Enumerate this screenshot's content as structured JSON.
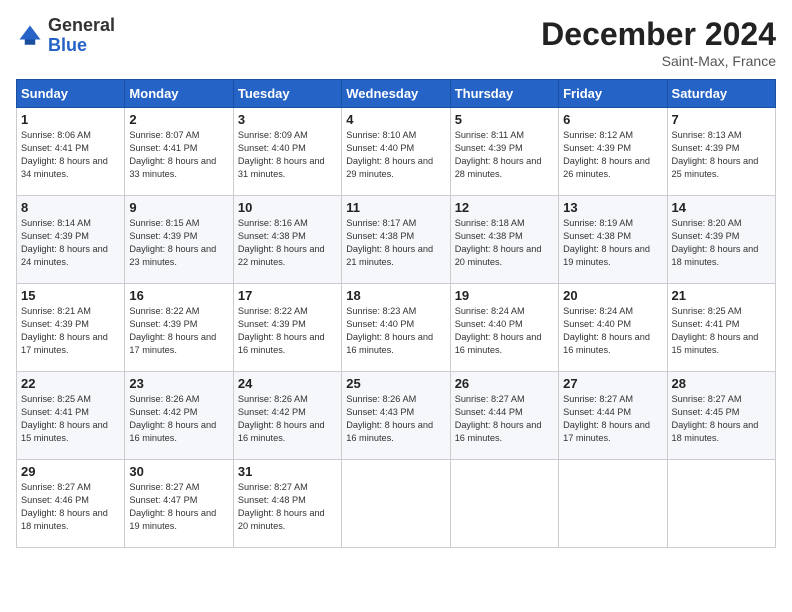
{
  "header": {
    "logo_general": "General",
    "logo_blue": "Blue",
    "month": "December 2024",
    "location": "Saint-Max, France"
  },
  "days_of_week": [
    "Sunday",
    "Monday",
    "Tuesday",
    "Wednesday",
    "Thursday",
    "Friday",
    "Saturday"
  ],
  "weeks": [
    [
      {
        "day": "1",
        "rise": "Sunrise: 8:06 AM",
        "set": "Sunset: 4:41 PM",
        "daylight": "Daylight: 8 hours and 34 minutes."
      },
      {
        "day": "2",
        "rise": "Sunrise: 8:07 AM",
        "set": "Sunset: 4:41 PM",
        "daylight": "Daylight: 8 hours and 33 minutes."
      },
      {
        "day": "3",
        "rise": "Sunrise: 8:09 AM",
        "set": "Sunset: 4:40 PM",
        "daylight": "Daylight: 8 hours and 31 minutes."
      },
      {
        "day": "4",
        "rise": "Sunrise: 8:10 AM",
        "set": "Sunset: 4:40 PM",
        "daylight": "Daylight: 8 hours and 29 minutes."
      },
      {
        "day": "5",
        "rise": "Sunrise: 8:11 AM",
        "set": "Sunset: 4:39 PM",
        "daylight": "Daylight: 8 hours and 28 minutes."
      },
      {
        "day": "6",
        "rise": "Sunrise: 8:12 AM",
        "set": "Sunset: 4:39 PM",
        "daylight": "Daylight: 8 hours and 26 minutes."
      },
      {
        "day": "7",
        "rise": "Sunrise: 8:13 AM",
        "set": "Sunset: 4:39 PM",
        "daylight": "Daylight: 8 hours and 25 minutes."
      }
    ],
    [
      {
        "day": "8",
        "rise": "Sunrise: 8:14 AM",
        "set": "Sunset: 4:39 PM",
        "daylight": "Daylight: 8 hours and 24 minutes."
      },
      {
        "day": "9",
        "rise": "Sunrise: 8:15 AM",
        "set": "Sunset: 4:39 PM",
        "daylight": "Daylight: 8 hours and 23 minutes."
      },
      {
        "day": "10",
        "rise": "Sunrise: 8:16 AM",
        "set": "Sunset: 4:38 PM",
        "daylight": "Daylight: 8 hours and 22 minutes."
      },
      {
        "day": "11",
        "rise": "Sunrise: 8:17 AM",
        "set": "Sunset: 4:38 PM",
        "daylight": "Daylight: 8 hours and 21 minutes."
      },
      {
        "day": "12",
        "rise": "Sunrise: 8:18 AM",
        "set": "Sunset: 4:38 PM",
        "daylight": "Daylight: 8 hours and 20 minutes."
      },
      {
        "day": "13",
        "rise": "Sunrise: 8:19 AM",
        "set": "Sunset: 4:38 PM",
        "daylight": "Daylight: 8 hours and 19 minutes."
      },
      {
        "day": "14",
        "rise": "Sunrise: 8:20 AM",
        "set": "Sunset: 4:39 PM",
        "daylight": "Daylight: 8 hours and 18 minutes."
      }
    ],
    [
      {
        "day": "15",
        "rise": "Sunrise: 8:21 AM",
        "set": "Sunset: 4:39 PM",
        "daylight": "Daylight: 8 hours and 17 minutes."
      },
      {
        "day": "16",
        "rise": "Sunrise: 8:22 AM",
        "set": "Sunset: 4:39 PM",
        "daylight": "Daylight: 8 hours and 17 minutes."
      },
      {
        "day": "17",
        "rise": "Sunrise: 8:22 AM",
        "set": "Sunset: 4:39 PM",
        "daylight": "Daylight: 8 hours and 16 minutes."
      },
      {
        "day": "18",
        "rise": "Sunrise: 8:23 AM",
        "set": "Sunset: 4:40 PM",
        "daylight": "Daylight: 8 hours and 16 minutes."
      },
      {
        "day": "19",
        "rise": "Sunrise: 8:24 AM",
        "set": "Sunset: 4:40 PM",
        "daylight": "Daylight: 8 hours and 16 minutes."
      },
      {
        "day": "20",
        "rise": "Sunrise: 8:24 AM",
        "set": "Sunset: 4:40 PM",
        "daylight": "Daylight: 8 hours and 16 minutes."
      },
      {
        "day": "21",
        "rise": "Sunrise: 8:25 AM",
        "set": "Sunset: 4:41 PM",
        "daylight": "Daylight: 8 hours and 15 minutes."
      }
    ],
    [
      {
        "day": "22",
        "rise": "Sunrise: 8:25 AM",
        "set": "Sunset: 4:41 PM",
        "daylight": "Daylight: 8 hours and 15 minutes."
      },
      {
        "day": "23",
        "rise": "Sunrise: 8:26 AM",
        "set": "Sunset: 4:42 PM",
        "daylight": "Daylight: 8 hours and 16 minutes."
      },
      {
        "day": "24",
        "rise": "Sunrise: 8:26 AM",
        "set": "Sunset: 4:42 PM",
        "daylight": "Daylight: 8 hours and 16 minutes."
      },
      {
        "day": "25",
        "rise": "Sunrise: 8:26 AM",
        "set": "Sunset: 4:43 PM",
        "daylight": "Daylight: 8 hours and 16 minutes."
      },
      {
        "day": "26",
        "rise": "Sunrise: 8:27 AM",
        "set": "Sunset: 4:44 PM",
        "daylight": "Daylight: 8 hours and 16 minutes."
      },
      {
        "day": "27",
        "rise": "Sunrise: 8:27 AM",
        "set": "Sunset: 4:44 PM",
        "daylight": "Daylight: 8 hours and 17 minutes."
      },
      {
        "day": "28",
        "rise": "Sunrise: 8:27 AM",
        "set": "Sunset: 4:45 PM",
        "daylight": "Daylight: 8 hours and 18 minutes."
      }
    ],
    [
      {
        "day": "29",
        "rise": "Sunrise: 8:27 AM",
        "set": "Sunset: 4:46 PM",
        "daylight": "Daylight: 8 hours and 18 minutes."
      },
      {
        "day": "30",
        "rise": "Sunrise: 8:27 AM",
        "set": "Sunset: 4:47 PM",
        "daylight": "Daylight: 8 hours and 19 minutes."
      },
      {
        "day": "31",
        "rise": "Sunrise: 8:27 AM",
        "set": "Sunset: 4:48 PM",
        "daylight": "Daylight: 8 hours and 20 minutes."
      },
      null,
      null,
      null,
      null
    ]
  ]
}
